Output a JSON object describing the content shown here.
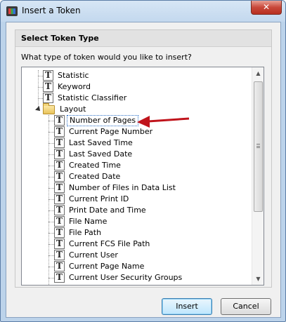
{
  "window": {
    "title": "Insert a Token",
    "close_glyph": "✕"
  },
  "group": {
    "title": "Select Token Type",
    "question": "What type of token would you like to insert?"
  },
  "tree": {
    "icon_glyph": "T",
    "top_items": [
      "Statistic",
      "Keyword",
      "Statistic Classifier"
    ],
    "folder": {
      "label": "Layout",
      "expanded": true
    },
    "children": [
      "Number of Pages",
      "Current Page Number",
      "Last Saved Time",
      "Last Saved Date",
      "Created Time",
      "Created Date",
      "Number of Files in Data List",
      "Current Print ID",
      "Print Date and Time",
      "File Name",
      "File Path",
      "Current FCS File Path",
      "Current User",
      "Current Page Name",
      "Current User Security Groups"
    ],
    "selected": "Number of Pages",
    "annotation_color": "#c0141c"
  },
  "buttons": {
    "insert": "Insert",
    "cancel": "Cancel"
  }
}
